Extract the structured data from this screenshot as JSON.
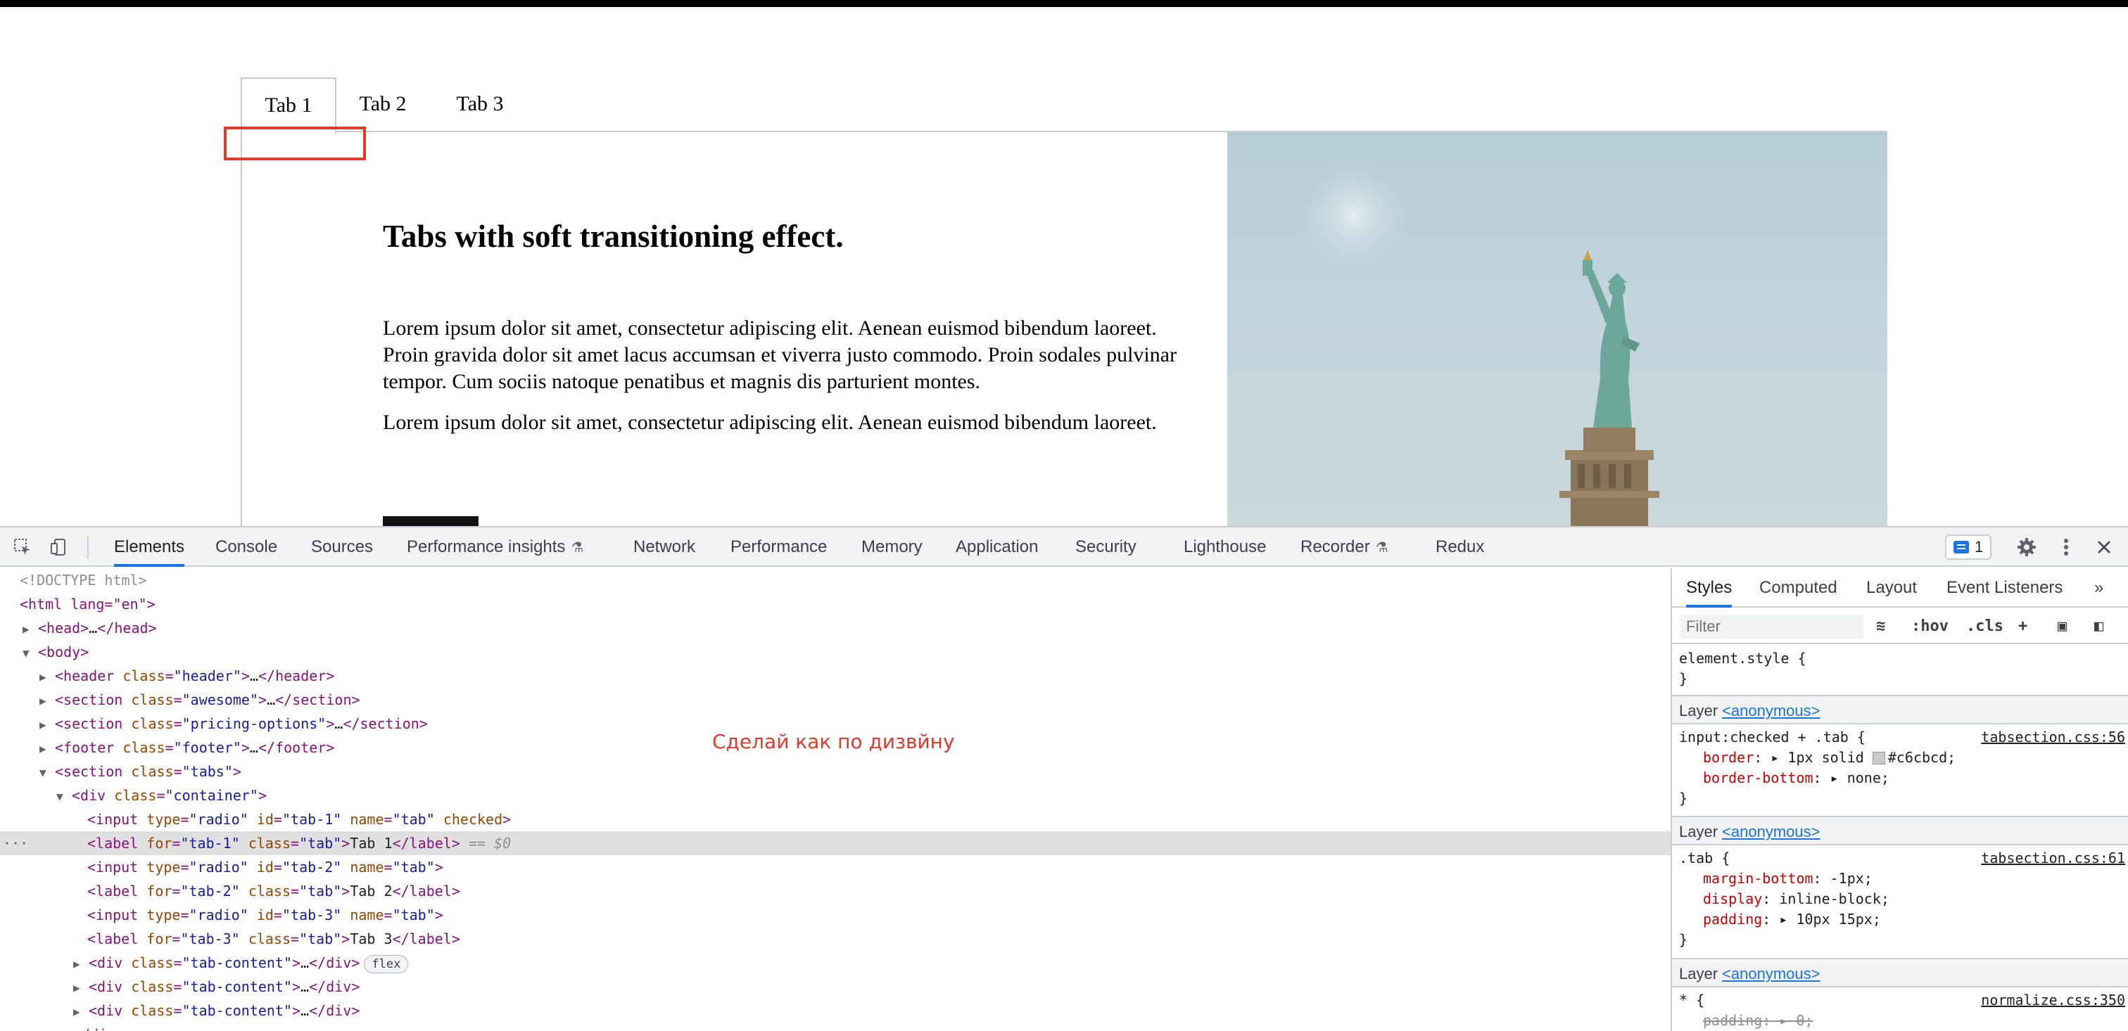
{
  "page": {
    "tabs": [
      "Tab 1",
      "Tab 2",
      "Tab 3"
    ],
    "active_tab": "Tab 1",
    "title": "Tabs with soft transitioning effect.",
    "paragraph_1": "Lorem ipsum dolor sit amet, consectetur adipiscing elit. Aenean euismod bibendum laoreet. Proin gravida dolor sit amet lacus accumsan et viverra justo commodo. Proin sodales pulvinar tempor. Cum sociis natoque penatibus et magnis dis parturient montes.",
    "paragraph_2": "Lorem ipsum dolor sit amet, consectetur adipiscing elit. Aenean euismod bibendum laoreet.",
    "highlight_color": "#e23b2a"
  },
  "devtools": {
    "tabs": [
      "Elements",
      "Console",
      "Sources",
      "Performance insights",
      "Network",
      "Performance",
      "Memory",
      "Application",
      "Security",
      "Lighthouse",
      "Recorder",
      "Redux"
    ],
    "active_tab": "Elements",
    "issues_count": "1",
    "annotation": "Сделай как по дизвйну",
    "dom": {
      "doctype": "<!DOCTYPE html>",
      "html_open": "<html lang=\"en\">",
      "selected_marker": "== $0"
    },
    "styles_pane": {
      "tabs": [
        "Styles",
        "Computed",
        "Layout",
        "Event Listeners"
      ],
      "active_tab": "Styles",
      "filter_placeholder": "Filter",
      "hov": ":hov",
      "cls": ".cls",
      "element_style": "element.style {",
      "close_brace": "}",
      "layer_label": "Layer",
      "layer_link": "<anonymous>",
      "rules": [
        {
          "selector": "input:checked + .tab {",
          "source": "tabsection.css:56",
          "props": [
            {
              "name": "border",
              "value": "1px solid",
              "color": "#c6cbcd",
              "color_text": "#c6cbcd;"
            },
            {
              "name": "border-bottom",
              "value": "none;"
            }
          ]
        },
        {
          "selector": ".tab {",
          "source": "tabsection.css:61",
          "props": [
            {
              "name": "margin-bottom",
              "value": "-1px;"
            },
            {
              "name": "display",
              "value": "inline-block;"
            },
            {
              "name": "padding",
              "value": "10px 15px;"
            }
          ]
        },
        {
          "selector": "* {",
          "source": "normalize.css:350",
          "props": [
            {
              "name": "padding",
              "value": "0;",
              "struck": true
            }
          ]
        }
      ]
    }
  }
}
